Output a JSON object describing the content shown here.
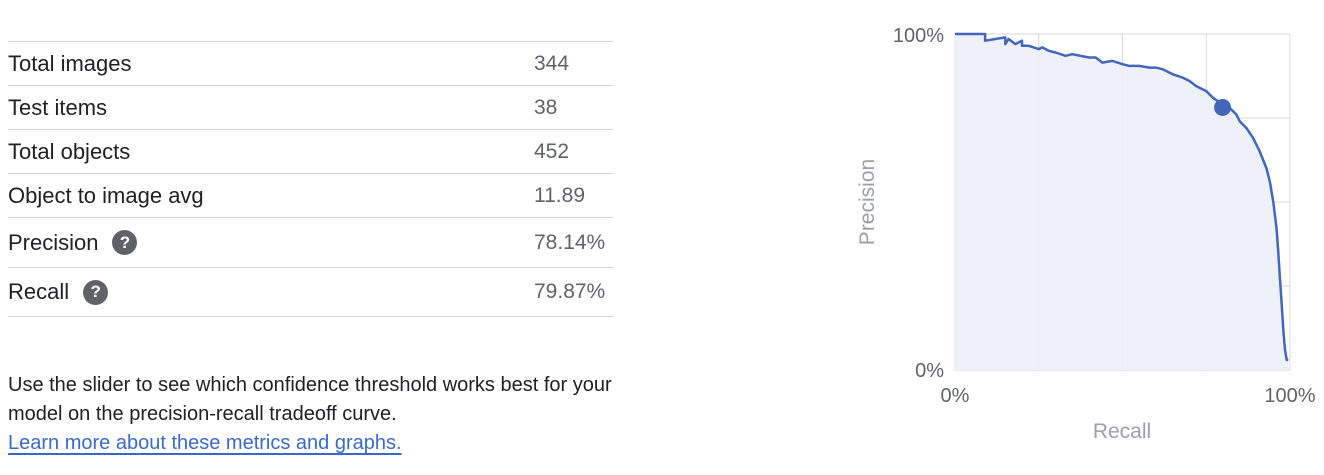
{
  "metrics": [
    {
      "label": "Total images",
      "value": "344"
    },
    {
      "label": "Test items",
      "value": "38"
    },
    {
      "label": "Total objects",
      "value": "452"
    },
    {
      "label": "Object to image avg",
      "value": "11.89"
    },
    {
      "label": "Precision",
      "value": "78.14%",
      "help_icon": "help-icon"
    },
    {
      "label": "Recall",
      "value": "79.87%",
      "help_icon": "help-icon"
    }
  ],
  "description": {
    "line1": "Use the slider to see which confidence threshold works best for your",
    "line2": "model on the precision-recall tradeoff curve.",
    "link": "Learn more about these metrics and graphs."
  },
  "chart_data": {
    "type": "area",
    "xlabel": "Recall",
    "ylabel": "Precision",
    "x_tick_labels": [
      "0%",
      "100%"
    ],
    "y_tick_labels": [
      "0%",
      "100%"
    ],
    "xlim": [
      0,
      1
    ],
    "ylim": [
      0,
      1
    ],
    "grid": true,
    "line_color": "#4466b8",
    "fill_color": "#eceff9",
    "series": [
      {
        "x": [
          0,
          0.03,
          0.09,
          0.09,
          0.15,
          0.15,
          0.16,
          0.18,
          0.2,
          0.2,
          0.22,
          0.25,
          0.26,
          0.28,
          0.3,
          0.33,
          0.35,
          0.4,
          0.42,
          0.44,
          0.47,
          0.5,
          0.52,
          0.55,
          0.58,
          0.6,
          0.62,
          0.65,
          0.68,
          0.7,
          0.72,
          0.75,
          0.77,
          0.8,
          0.82,
          0.84,
          0.85,
          0.87,
          0.89,
          0.91,
          0.93,
          0.94,
          0.95,
          0.96,
          0.965,
          0.97,
          0.975,
          0.98,
          0.985,
          0.99,
          0.995
        ],
        "y": [
          1,
          1,
          1,
          0.98,
          0.99,
          0.97,
          0.985,
          0.97,
          0.98,
          0.965,
          0.965,
          0.955,
          0.96,
          0.95,
          0.945,
          0.935,
          0.94,
          0.93,
          0.93,
          0.915,
          0.92,
          0.91,
          0.905,
          0.905,
          0.9,
          0.9,
          0.895,
          0.88,
          0.87,
          0.86,
          0.845,
          0.83,
          0.81,
          0.79,
          0.78,
          0.76,
          0.74,
          0.72,
          0.69,
          0.65,
          0.6,
          0.56,
          0.5,
          0.42,
          0.35,
          0.27,
          0.2,
          0.12,
          0.06,
          0.03,
          0.03
        ]
      }
    ],
    "threshold_point": {
      "x": 0.7987,
      "y": 0.7814
    }
  }
}
